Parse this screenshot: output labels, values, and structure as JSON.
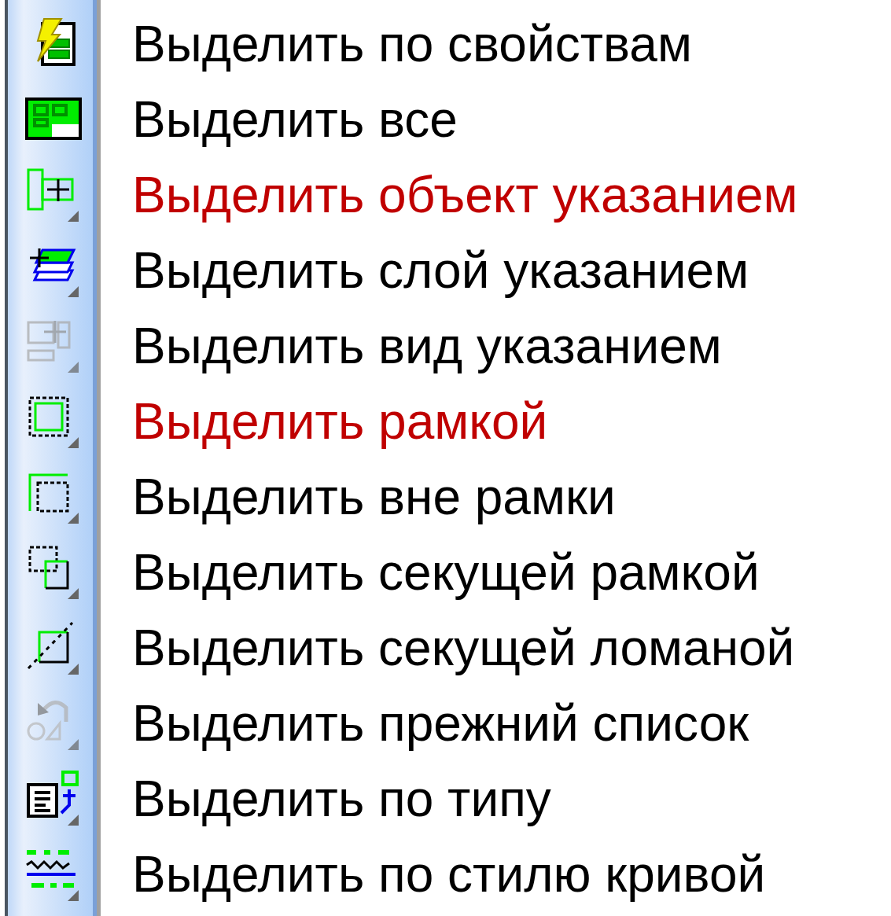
{
  "toolbar_items": [
    {
      "kind": "properties",
      "label": "Выделить по свойствам",
      "highlighted": false,
      "disabled": false,
      "has_submenu": false
    },
    {
      "kind": "all",
      "label": "Выделить все",
      "highlighted": false,
      "disabled": false,
      "has_submenu": false
    },
    {
      "kind": "object",
      "label": "Выделить объект указанием",
      "highlighted": true,
      "disabled": false,
      "has_submenu": true
    },
    {
      "kind": "layer",
      "label": "Выделить слой указанием",
      "highlighted": false,
      "disabled": false,
      "has_submenu": true
    },
    {
      "kind": "view",
      "label": "Выделить вид указанием",
      "highlighted": false,
      "disabled": true,
      "has_submenu": true
    },
    {
      "kind": "frame",
      "label": "Выделить рамкой",
      "highlighted": true,
      "disabled": false,
      "has_submenu": true
    },
    {
      "kind": "outside",
      "label": "Выделить вне рамки",
      "highlighted": false,
      "disabled": false,
      "has_submenu": true
    },
    {
      "kind": "crossing",
      "label": "Выделить секущей рамкой",
      "highlighted": false,
      "disabled": false,
      "has_submenu": true
    },
    {
      "kind": "polyline",
      "label": "Выделить секущей ломаной",
      "highlighted": false,
      "disabled": false,
      "has_submenu": true
    },
    {
      "kind": "previous",
      "label": "Выделить прежний список",
      "highlighted": false,
      "disabled": true,
      "has_submenu": true
    },
    {
      "kind": "type",
      "label": "Выделить по типу",
      "highlighted": false,
      "disabled": false,
      "has_submenu": true
    },
    {
      "kind": "curve-style",
      "label": "Выделить по стилю кривой",
      "highlighted": false,
      "disabled": false,
      "has_submenu": true
    }
  ]
}
